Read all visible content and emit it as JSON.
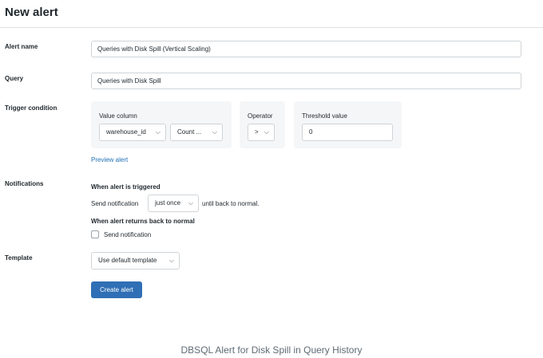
{
  "page": {
    "title": "New alert"
  },
  "alert_name": {
    "label": "Alert name",
    "value": "Queries with Disk Spill (Vertical Scaling)"
  },
  "query": {
    "label": "Query",
    "value": "Queries with Disk Spill"
  },
  "trigger": {
    "label": "Trigger condition",
    "value_column": {
      "label": "Value column",
      "column_select": "warehouse_id",
      "aggregate_select": "Count ..."
    },
    "operator": {
      "label": "Operator",
      "value": ">"
    },
    "threshold": {
      "label": "Threshold value",
      "value": "0"
    },
    "preview_link": "Preview alert"
  },
  "notifications": {
    "label": "Notifications",
    "triggered_heading": "When alert is triggered",
    "send_prefix": "Send notification",
    "frequency_select": "just once",
    "send_suffix": "until back to normal.",
    "normal_heading": "When alert returns back to normal",
    "send_checkbox_label": "Send notification"
  },
  "template": {
    "label": "Template",
    "select": "Use default template"
  },
  "actions": {
    "create_button": "Create alert"
  },
  "caption": "DBSQL Alert for Disk Spill in Query History",
  "icons": {
    "dropdown": "chevron-down-icon"
  },
  "colors": {
    "primary": "#2f6fb5",
    "link": "#2272b4",
    "panel_bg": "#f5f6f7"
  }
}
